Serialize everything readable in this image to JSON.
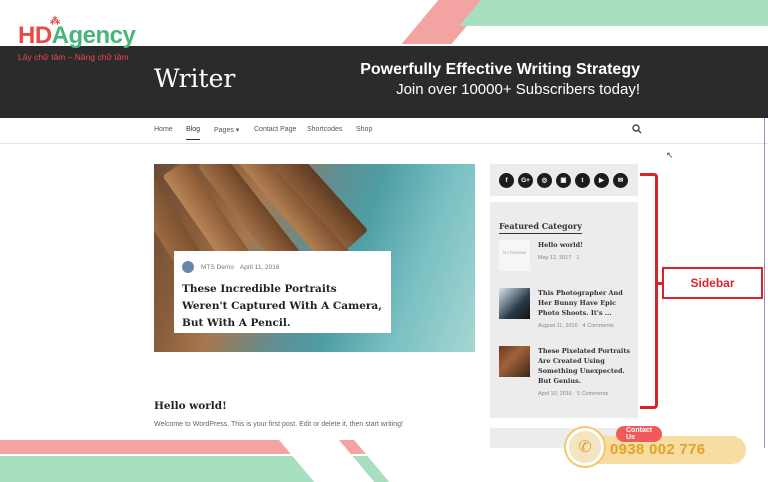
{
  "brand": {
    "name_hd": "HD",
    "name_agency": "Agency",
    "tagline": "Lấy chữ tâm – Nâng chữ tầm"
  },
  "site": {
    "logo": "Writer",
    "promo_line1": "Powerfully Effective Writing Strategy",
    "promo_line2": "Join over 10000+ Subscribers today!"
  },
  "nav": {
    "items": [
      "Home",
      "Blog",
      "Pages ▾",
      "Contact Page",
      "Shortcodes",
      "Shop"
    ],
    "active": "Blog"
  },
  "featured_post": {
    "author": "MTS Demo",
    "date": "April 11, 2016",
    "title": "These Incredible Portraits Weren't Captured With A Camera, But With A Pencil."
  },
  "post": {
    "title": "Hello world!",
    "excerpt": "Welcome to WordPress. This is your first post. Edit or delete it, then start writing!"
  },
  "sidebar": {
    "social": [
      "f",
      "G+",
      "◎",
      "▣",
      "t",
      "▶",
      "✉"
    ],
    "featured_heading": "Featured Category",
    "no_preview": "No Preview",
    "items": [
      {
        "title": "Hello world!",
        "date": "May 12, 2017",
        "comments": "1"
      },
      {
        "title": "This Photographer And Her Bunny Have Epic Photo Shoots. It's ...",
        "date": "August 11, 2016",
        "comments": "4 Comments"
      },
      {
        "title": "These Pixelated Portraits Are Created Using Something Unexpected. But Genius.",
        "date": "April 10, 2016",
        "comments": "5 Comments"
      }
    ]
  },
  "annotation": {
    "label": "Sidebar",
    "color": "#d9232a"
  },
  "contact": {
    "tag": "Contact Us",
    "phone": "0938 002 776"
  },
  "colors": {
    "header_bg": "#2b2b2b",
    "sidebar_bg": "#ececec",
    "accent_red": "#d9232a",
    "brand_green": "#48b57a",
    "brand_red": "#e84a4a"
  }
}
